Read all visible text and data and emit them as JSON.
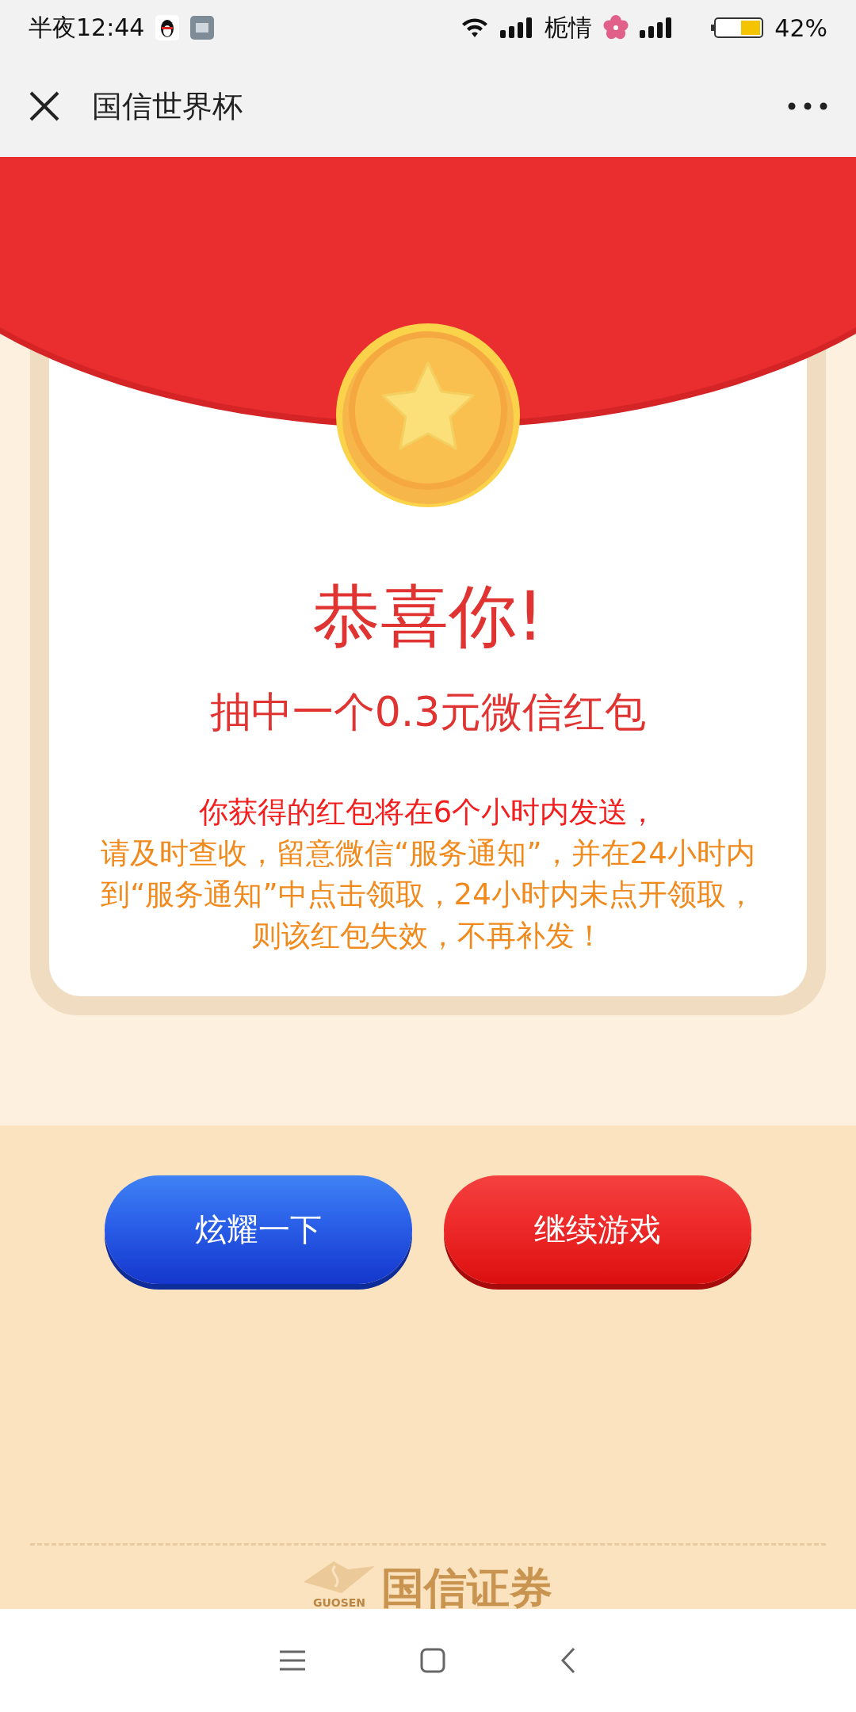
{
  "status_bar": {
    "time": "半夜12:44",
    "carrier": "栀情",
    "battery": "42%"
  },
  "header": {
    "title": "国信世界杯"
  },
  "result": {
    "title": "恭喜你!",
    "prize": "抽中一个0.3元微信红包",
    "notice": "你获得的红包将在6个小时内发送，",
    "instructions": "请及时查收，留意微信“服务通知”，并在24小时内到“服务通知”中点击领取，24小时内未点开领取，则该红包失效，不再补发！"
  },
  "buttons": [
    {
      "label": "炫耀一下",
      "kind": "share"
    },
    {
      "label": "继续游戏",
      "kind": "continue"
    }
  ],
  "footer": {
    "logo_text": "国信证券",
    "logo_caption": "GUOSEN"
  }
}
